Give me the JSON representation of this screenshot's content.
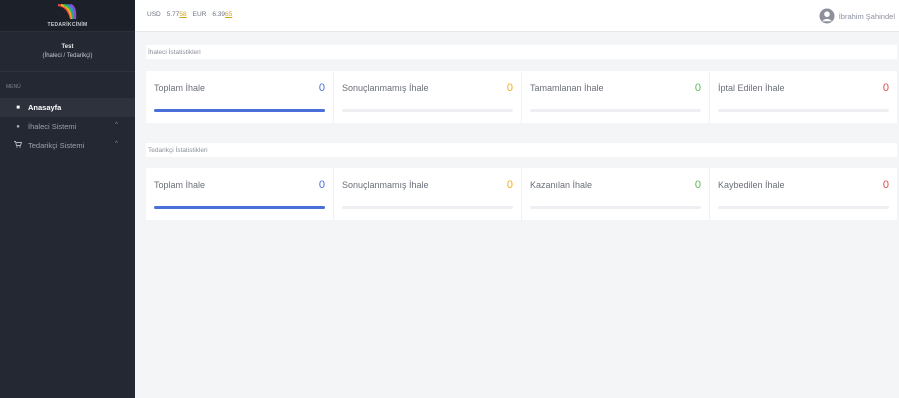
{
  "brand": {
    "name": "TEDARİKCİNİM"
  },
  "user_box": {
    "name": "Test",
    "role": "(İhaleci / Tedarikçi)"
  },
  "sidebar": {
    "menu_label": "MENÜ",
    "items": [
      {
        "label": "Anasayfa",
        "icon": "home-icon",
        "glyph": "■",
        "active": true
      },
      {
        "label": "İhaleci Sistemi",
        "icon": "globe-icon",
        "glyph": "●",
        "active": false
      },
      {
        "label": "Tedarikçi Sistemi",
        "icon": "cart-icon",
        "glyph": "▾",
        "active": false
      }
    ]
  },
  "topbar": {
    "usd_label": "USD",
    "usd_value_a": "5.77",
    "usd_value_b": "58",
    "eur_label": "EUR",
    "eur_value_a": "6.39",
    "eur_value_b": "65",
    "user_name": "İbrahim Şahindel"
  },
  "sections": [
    {
      "title": "İhaleci İstatistikleri",
      "stats": [
        {
          "label": "Toplam İhale",
          "value": "0",
          "color": "#4a6fd8",
          "fill": 1.0
        },
        {
          "label": "Sonuçlanmamış İhale",
          "value": "0",
          "color": "#f0ad18",
          "fill": 0
        },
        {
          "label": "Tamamlanan İhale",
          "value": "0",
          "color": "#5cb85c",
          "fill": 0
        },
        {
          "label": "İptal Edilen İhale",
          "value": "0",
          "color": "#e04b45",
          "fill": 0
        }
      ]
    },
    {
      "title": "Tedarikçi İstatistikleri",
      "stats": [
        {
          "label": "Toplam İhale",
          "value": "0",
          "color": "#4a6fd8",
          "fill": 1.0
        },
        {
          "label": "Sonuçlanmamış İhale",
          "value": "0",
          "color": "#f0ad18",
          "fill": 0
        },
        {
          "label": "Kazanılan İhale",
          "value": "0",
          "color": "#5cb85c",
          "fill": 0
        },
        {
          "label": "Kaybedilen İhale",
          "value": "0",
          "color": "#e04b45",
          "fill": 0
        }
      ]
    }
  ]
}
